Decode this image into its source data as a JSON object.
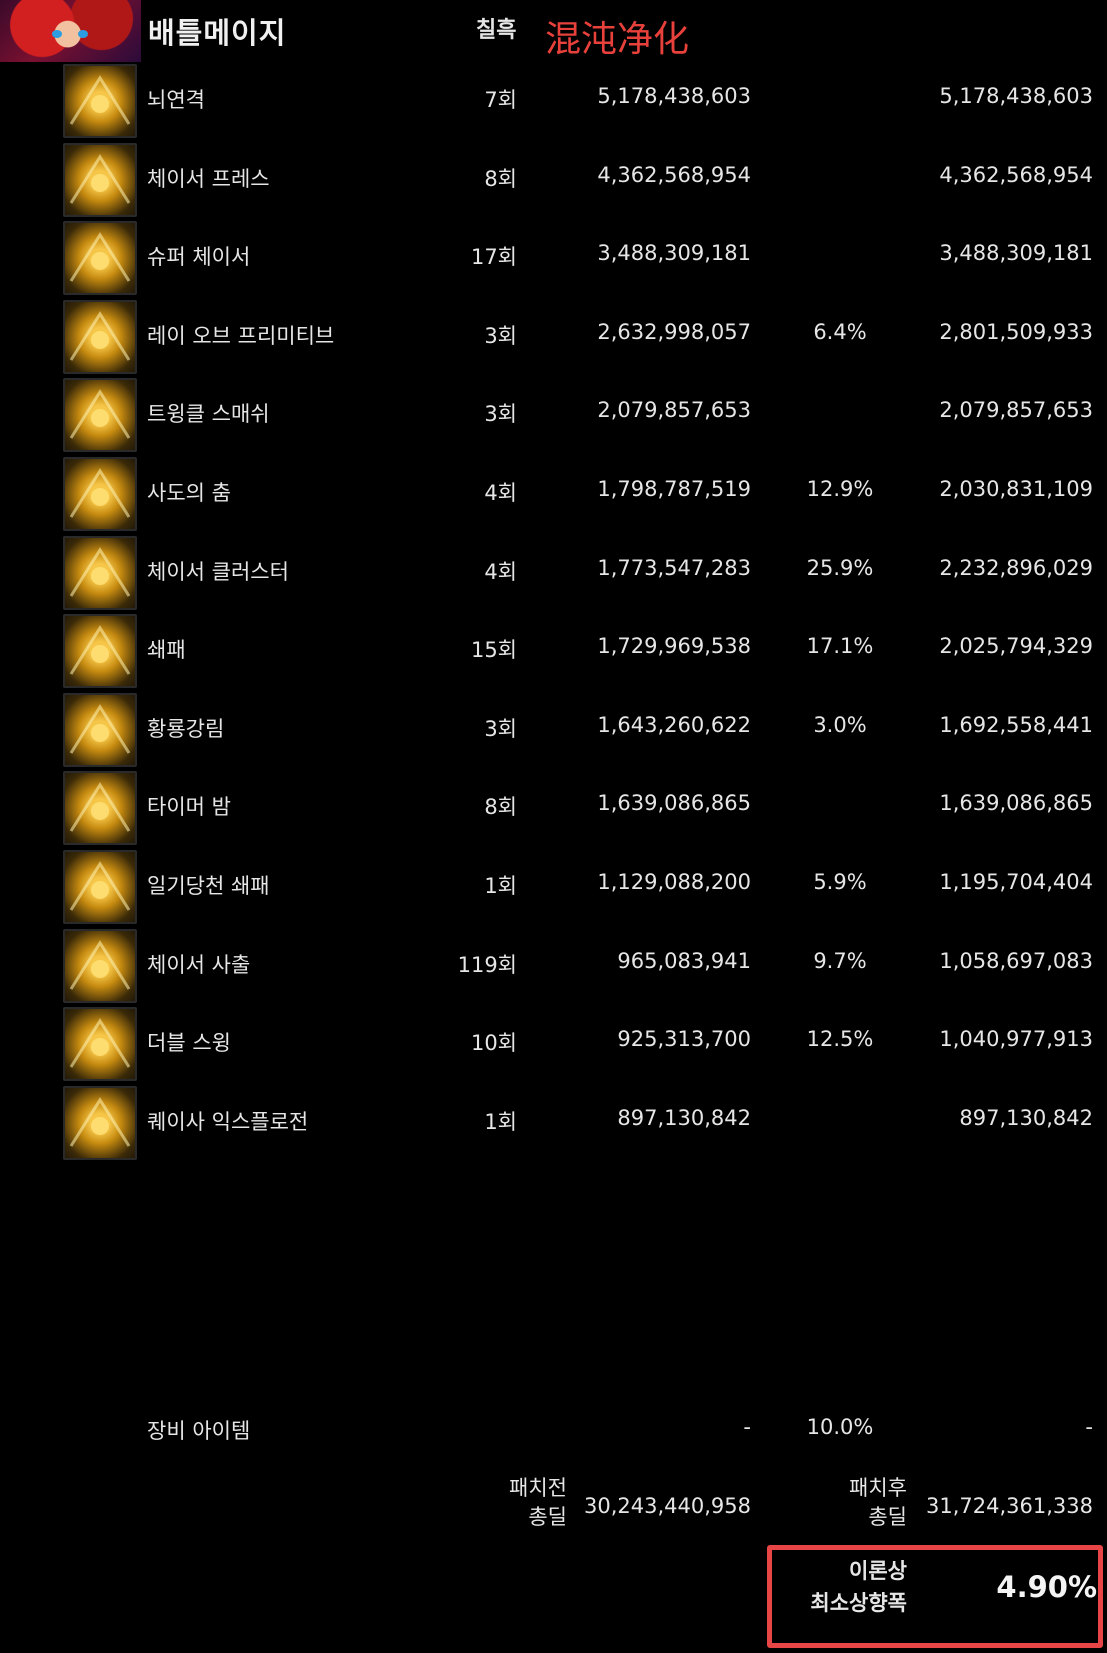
{
  "header": {
    "title": "배틀메이지",
    "column_label": "칠흑",
    "red_label": "混沌净化"
  },
  "skills": [
    {
      "name": "뇌연격",
      "hits": "7회",
      "damage": "5,178,438,603",
      "pct": "",
      "after": "5,178,438,603",
      "icon": "lightning-icon"
    },
    {
      "name": "체이서 프레스",
      "hits": "8회",
      "damage": "4,362,568,954",
      "pct": "",
      "after": "4,362,568,954",
      "icon": "flame-orb-icon"
    },
    {
      "name": "슈퍼 체이서",
      "hits": "17회",
      "damage": "3,488,309,181",
      "pct": "",
      "after": "3,488,309,181",
      "icon": "star-swirl-icon"
    },
    {
      "name": "레이 오브 프리미티브",
      "hits": "3회",
      "damage": "2,632,998,057",
      "pct": "6.4%",
      "after": "2,801,509,933",
      "icon": "ray-burst-icon"
    },
    {
      "name": "트윙클 스매쉬",
      "hits": "3회",
      "damage": "2,079,857,653",
      "pct": "",
      "after": "2,079,857,653",
      "icon": "staff-smash-icon"
    },
    {
      "name": "사도의 춤",
      "hits": "4회",
      "damage": "1,798,787,519",
      "pct": "12.9%",
      "after": "2,030,831,109",
      "icon": "dance-wave-icon"
    },
    {
      "name": "체이서 클러스터",
      "hits": "4회",
      "damage": "1,773,547,283",
      "pct": "25.9%",
      "after": "2,232,896,029",
      "icon": "star-cluster-icon"
    },
    {
      "name": "쇄패",
      "hits": "15회",
      "damage": "1,729,969,538",
      "pct": "17.1%",
      "after": "2,025,794,329",
      "icon": "club-icon"
    },
    {
      "name": "황룡강림",
      "hits": "3회",
      "damage": "1,643,260,622",
      "pct": "3.0%",
      "after": "1,692,558,441",
      "icon": "dragon-descent-icon"
    },
    {
      "name": "타이머 밤",
      "hits": "8회",
      "damage": "1,639,086,865",
      "pct": "",
      "after": "1,639,086,865",
      "icon": "star-bomb-icon"
    },
    {
      "name": "일기당천 쇄패",
      "hits": "1회",
      "damage": "1,129,088,200",
      "pct": "5.9%",
      "after": "1,195,704,404",
      "icon": "orange-slash-icon"
    },
    {
      "name": "체이서 사출",
      "hits": "119회",
      "damage": "965,083,941",
      "pct": "9.7%",
      "after": "1,058,697,083",
      "icon": "star-shot-icon"
    },
    {
      "name": "더블 스윙",
      "hits": "10회",
      "damage": "925,313,700",
      "pct": "12.5%",
      "after": "1,040,977,913",
      "icon": "double-swing-icon"
    },
    {
      "name": "퀘이사 익스플로전",
      "hits": "1회",
      "damage": "897,130,842",
      "pct": "",
      "after": "897,130,842",
      "icon": "quasar-explosion-icon"
    }
  ],
  "equipment": {
    "name": "장비 아이템",
    "damage": "-",
    "pct": "10.0%",
    "after": "-"
  },
  "totals": {
    "before_label_1": "패치전",
    "before_label_2": "총딜",
    "before_value": "30,243,440,958",
    "after_label_1": "패치후",
    "after_label_2": "총딜",
    "after_value": "31,724,361,338"
  },
  "result": {
    "label_1": "이론상",
    "label_2": "최소상향폭",
    "value": "4.90%",
    "border_color": "#e84646"
  },
  "colors": {
    "background": "#000000",
    "text": "#e6e6e6",
    "accent_red": "#e8413c",
    "icon_gold": "#f6c648"
  }
}
